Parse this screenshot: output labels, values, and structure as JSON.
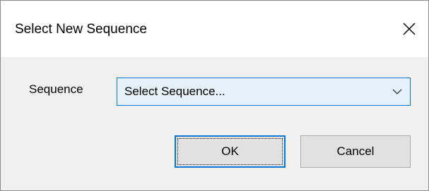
{
  "window": {
    "title": "Select New Sequence",
    "close_icon": "close-icon"
  },
  "form": {
    "sequence_label": "Sequence",
    "sequence_select_value": "Select Sequence...",
    "dropdown_icon": "chevron-down-icon"
  },
  "buttons": {
    "ok_label": "OK",
    "cancel_label": "Cancel"
  },
  "colors": {
    "accent": "#0078d7",
    "select_background": "#e5f1fb",
    "dialog_background": "#f0f0f0",
    "button_background": "#e1e1e1"
  }
}
